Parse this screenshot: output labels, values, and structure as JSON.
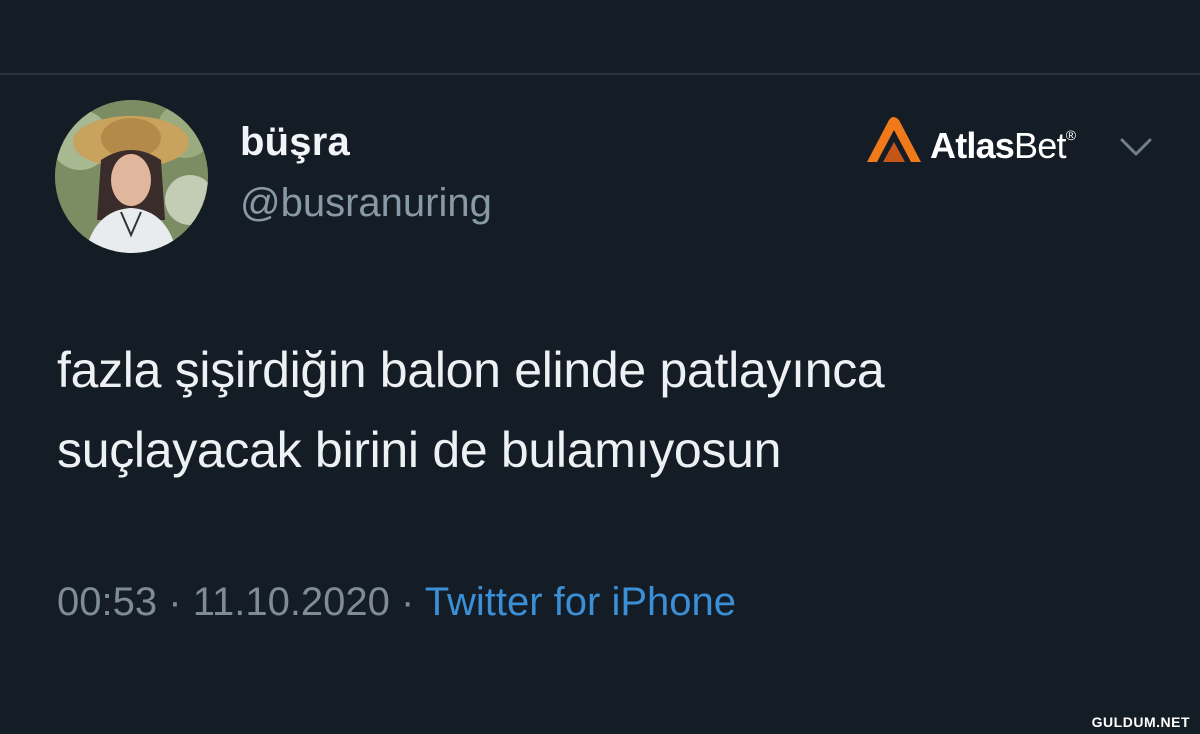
{
  "tweet": {
    "display_name": "büşra",
    "handle": "@busranuring",
    "text_lines": [
      "fazla şişirdiğin balon elinde patlayınca",
      "suçlayacak birini de bulamıyosun"
    ],
    "time": "00:53",
    "separator": "·",
    "date": "11.10.2020",
    "source": "Twitter for iPhone"
  },
  "brand": {
    "name_bold": "Atlas",
    "name_thin": "Bet",
    "registered": "®",
    "accent_color": "#f07a1a"
  },
  "icons": {
    "more": "chevron-down-icon",
    "avatar": "profile-avatar"
  },
  "watermark": "GULDUM.NET",
  "colors": {
    "background": "#141c26",
    "text": "#eef1f3",
    "secondary": "#8899a6",
    "link": "#3a8fd6"
  }
}
